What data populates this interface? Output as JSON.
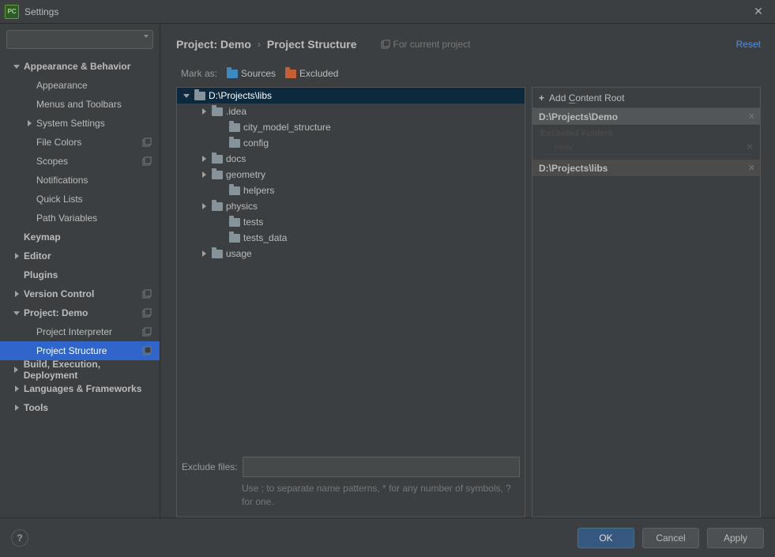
{
  "window": {
    "title": "Settings"
  },
  "search": {
    "placeholder": ""
  },
  "nav": [
    {
      "label": "Appearance & Behavior",
      "type": "group",
      "arrow": "down"
    },
    {
      "label": "Appearance",
      "type": "child"
    },
    {
      "label": "Menus and Toolbars",
      "type": "child"
    },
    {
      "label": "System Settings",
      "type": "child",
      "arrow": "right"
    },
    {
      "label": "File Colors",
      "type": "child",
      "proj": true
    },
    {
      "label": "Scopes",
      "type": "child",
      "proj": true
    },
    {
      "label": "Notifications",
      "type": "child"
    },
    {
      "label": "Quick Lists",
      "type": "child"
    },
    {
      "label": "Path Variables",
      "type": "child"
    },
    {
      "label": "Keymap",
      "type": "group"
    },
    {
      "label": "Editor",
      "type": "group",
      "arrow": "right"
    },
    {
      "label": "Plugins",
      "type": "group"
    },
    {
      "label": "Version Control",
      "type": "group",
      "arrow": "right",
      "proj": true
    },
    {
      "label": "Project: Demo",
      "type": "group",
      "arrow": "down",
      "proj": true
    },
    {
      "label": "Project Interpreter",
      "type": "child",
      "proj": true
    },
    {
      "label": "Project Structure",
      "type": "child",
      "proj": true,
      "selected": true
    },
    {
      "label": "Build, Execution, Deployment",
      "type": "group",
      "arrow": "right"
    },
    {
      "label": "Languages & Frameworks",
      "type": "group",
      "arrow": "right"
    },
    {
      "label": "Tools",
      "type": "group",
      "arrow": "right"
    }
  ],
  "breadcrumb": {
    "a": "Project: Demo",
    "b": "Project Structure",
    "hint": "For current project",
    "reset": "Reset"
  },
  "markas": {
    "label": "Mark as:",
    "sources": "Sources",
    "excluded": "Excluded"
  },
  "tree": [
    {
      "label": "D:\\Projects\\libs",
      "depth": 0,
      "arrow": "down",
      "folder": "gray",
      "selected": true
    },
    {
      "label": ".idea",
      "depth": 1,
      "arrow": "right",
      "folder": "gray"
    },
    {
      "label": "city_model_structure",
      "depth": 2,
      "folder": "gray"
    },
    {
      "label": "config",
      "depth": 2,
      "folder": "gray"
    },
    {
      "label": "docs",
      "depth": 1,
      "arrow": "right",
      "folder": "gray"
    },
    {
      "label": "geometry",
      "depth": 1,
      "arrow": "right",
      "folder": "gray"
    },
    {
      "label": "helpers",
      "depth": 2,
      "folder": "gray"
    },
    {
      "label": "physics",
      "depth": 1,
      "arrow": "right",
      "folder": "gray"
    },
    {
      "label": "tests",
      "depth": 2,
      "folder": "gray"
    },
    {
      "label": "tests_data",
      "depth": 2,
      "folder": "gray"
    },
    {
      "label": "usage",
      "depth": 1,
      "arrow": "right",
      "folder": "gray"
    }
  ],
  "exclude": {
    "label": "Exclude files:",
    "hint": "Use ; to separate name patterns, * for any number of symbols, ? for one."
  },
  "rightpanel": {
    "addRoot": "Add Content Root",
    "roots": [
      {
        "label": "D:\\Projects\\Demo",
        "sublabel": "Excluded Folders",
        "subitem": "venv",
        "closable": true,
        "active": true
      },
      {
        "label": "D:\\Projects\\libs",
        "closable": true
      }
    ]
  },
  "footer": {
    "ok": "OK",
    "cancel": "Cancel",
    "apply": "Apply"
  }
}
